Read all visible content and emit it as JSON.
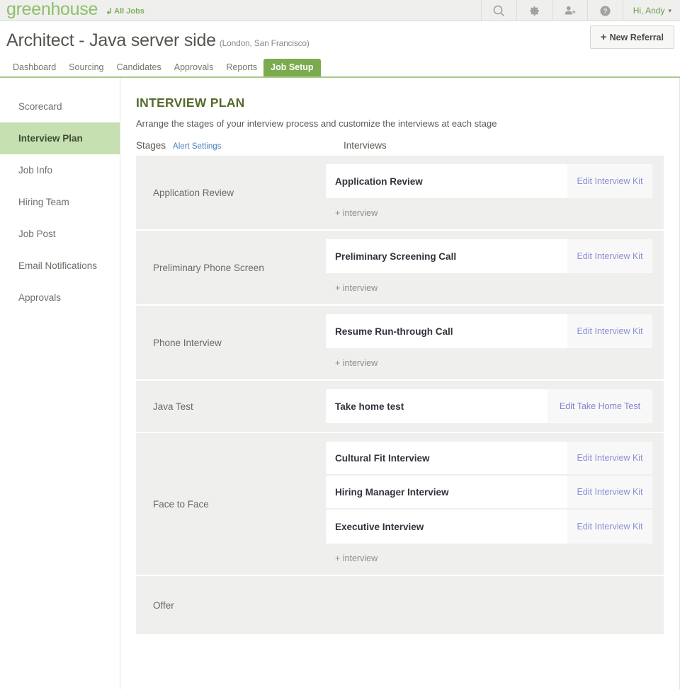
{
  "topbar": {
    "logo": "greenhouse",
    "all_jobs": "All Jobs",
    "all_jobs_icon": "return-arrow-icon",
    "icons": [
      "search-icon",
      "gear-icon",
      "add-user-icon",
      "help-icon"
    ],
    "greeting": "Hi, Andy",
    "caret": "▾"
  },
  "job": {
    "title": "Architect - Java server side",
    "locations": "(London, San Francisco)",
    "new_referral": "New Referral",
    "new_referral_plus": "+"
  },
  "tabs": [
    {
      "label": "Dashboard",
      "active": false
    },
    {
      "label": "Sourcing",
      "active": false
    },
    {
      "label": "Candidates",
      "active": false
    },
    {
      "label": "Approvals",
      "active": false
    },
    {
      "label": "Reports",
      "active": false
    },
    {
      "label": "Job Setup",
      "active": true
    }
  ],
  "sidebar": {
    "items": [
      {
        "label": "Scorecard",
        "active": false
      },
      {
        "label": "Interview Plan",
        "active": true
      },
      {
        "label": "Job Info",
        "active": false
      },
      {
        "label": "Hiring Team",
        "active": false
      },
      {
        "label": "Job Post",
        "active": false
      },
      {
        "label": "Email Notifications",
        "active": false
      },
      {
        "label": "Approvals",
        "active": false
      }
    ]
  },
  "main": {
    "title": "INTERVIEW PLAN",
    "subtitle": "Arrange the stages of your interview process and customize the interviews at each stage",
    "col_stages": "Stages",
    "col_alert_settings": "Alert Settings",
    "col_interviews": "Interviews",
    "add_interview_label": "+ interview",
    "stages": [
      {
        "name": "Application Review",
        "interviews": [
          {
            "name": "Application Review",
            "action": "Edit Interview Kit",
            "wide": false
          }
        ],
        "show_add": true
      },
      {
        "name": "Preliminary Phone Screen",
        "interviews": [
          {
            "name": "Preliminary Screening Call",
            "action": "Edit Interview Kit",
            "wide": false
          }
        ],
        "show_add": true
      },
      {
        "name": "Phone Interview",
        "interviews": [
          {
            "name": "Resume Run-through Call",
            "action": "Edit Interview Kit",
            "wide": false
          }
        ],
        "show_add": true
      },
      {
        "name": "Java Test",
        "interviews": [
          {
            "name": "Take home test",
            "action": "Edit Take Home Test",
            "wide": true
          }
        ],
        "show_add": false
      },
      {
        "name": "Face to Face",
        "interviews": [
          {
            "name": "Cultural Fit Interview",
            "action": "Edit Interview Kit",
            "wide": false
          },
          {
            "name": "Hiring Manager Interview",
            "action": "Edit Interview Kit",
            "wide": false
          },
          {
            "name": "Executive Interview",
            "action": "Edit Interview Kit",
            "wide": false
          }
        ],
        "show_add": true
      },
      {
        "name": "Offer",
        "interviews": [],
        "show_add": false
      }
    ]
  },
  "colors": {
    "brand_green": "#7bab4e",
    "logo_green": "#8dc06a",
    "active_sidebar": "#c7e0b2",
    "title_green": "#556b2b",
    "link_blue": "#4a7fbf",
    "action_link": "#8c8fd4"
  }
}
